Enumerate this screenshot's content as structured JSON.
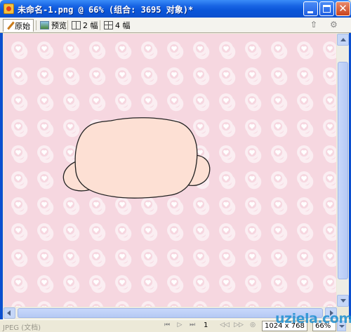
{
  "window": {
    "title": "未命名-1.png @  66% (组合: 3695 对象)*",
    "controls": {
      "minimize": "minimize",
      "maximize": "maximize",
      "close": "✕"
    }
  },
  "tabs": [
    {
      "label": "原始",
      "icon": "pencil-icon",
      "active": true
    },
    {
      "label": "预览",
      "icon": "preview-icon",
      "active": false
    },
    {
      "label": "2 幅",
      "icon": "two-up-icon",
      "active": false
    },
    {
      "label": "4 幅",
      "icon": "four-up-icon",
      "active": false
    }
  ],
  "toolbar_right": {
    "export_icon": "⇧",
    "settings_icon": "⚙"
  },
  "canvas": {
    "background_color": "#f6d7e0",
    "pattern": "white-circle-heart",
    "shape_fill": "#fde0d4",
    "shape_stroke": "#222222"
  },
  "status": {
    "format": "JPEG (文档)",
    "nav_first": "⏮",
    "nav_play": "▷",
    "nav_last": "⏭",
    "page": "1",
    "nav_prev": "◁◁",
    "nav_next": "▷▷",
    "nav_loop": "◎",
    "dimensions": "1024 x 768",
    "zoom": "66%"
  },
  "watermark": "uziela.com"
}
